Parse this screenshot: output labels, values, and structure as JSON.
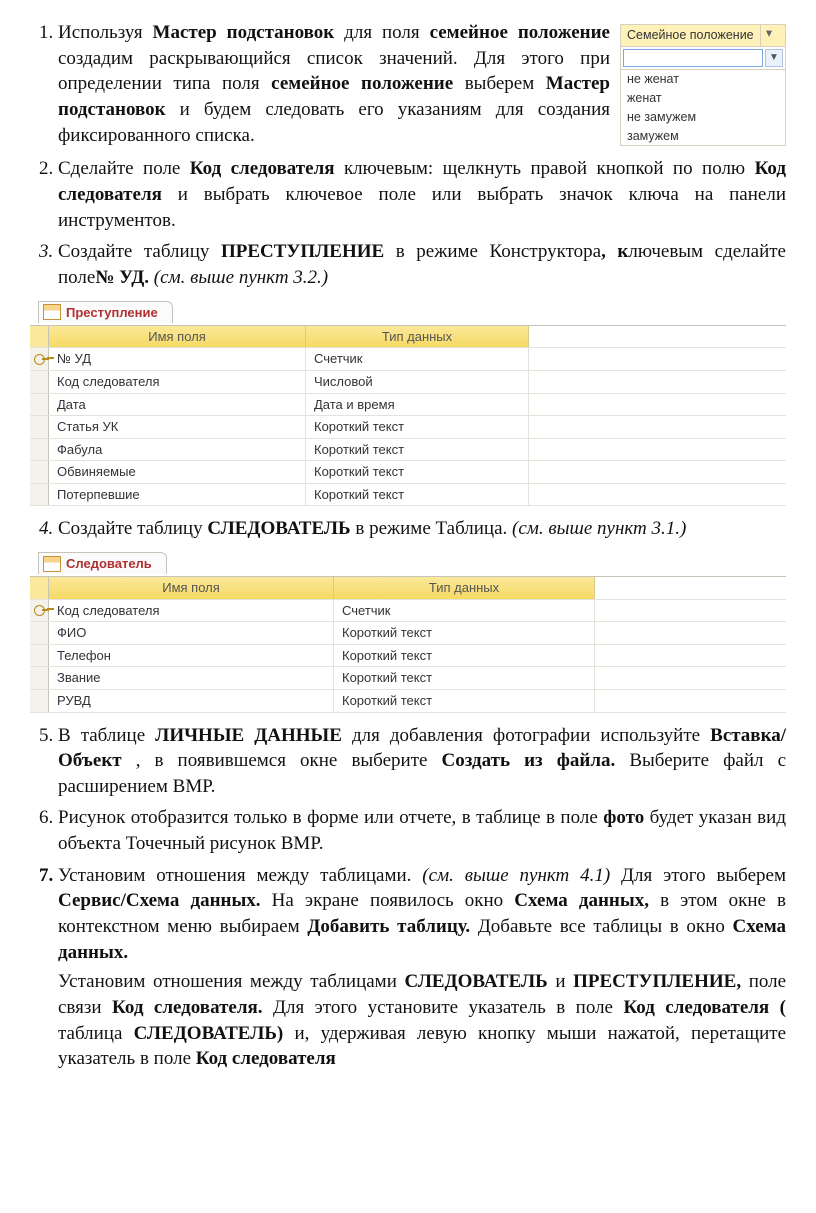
{
  "dropdown": {
    "header": "Семейное положение",
    "arrow": "▾",
    "btn": "▼",
    "options": [
      "не женат",
      "женат",
      "не замужем",
      "замужем"
    ]
  },
  "items": {
    "i1": {
      "t0": "Используя ",
      "b1": "Мастер подстановок",
      "t1": " для поля ",
      "b2": "семейное положение",
      "t2": " создадим раскрывающийся список значений. Для этого при определении типа поля ",
      "b3": "семейное положение",
      "t3": " выберем ",
      "b4": "Мастер подстановок",
      "t4": " и будем следовать его указаниям для создания фиксированного списка."
    },
    "i2": {
      "t0": "Сделайте поле ",
      "b1": "Код следователя",
      "t1": " ключевым: щелкнуть правой кнопкой по полю ",
      "b2": "Код следователя",
      "t2": " и выбрать ключевое поле или выбрать значок ключа на панели инструментов."
    },
    "i3": {
      "t0": "Создайте таблицу ",
      "b1": "ПРЕСТУПЛЕНИЕ",
      "t1": " в режиме Конструктора",
      "b2": ", к",
      "t2": "лючевым сделайте поле",
      "b3": "№ УД.",
      "it": " (см. выше пункт 3.2.)"
    },
    "i4": {
      "t0": "Создайте таблицу ",
      "b1": "СЛЕДОВАТЕЛЬ",
      "t1": " в режиме Таблица. ",
      "it": "(см. выше пункт 3.1.)"
    },
    "i5": {
      "t0": "В таблице ",
      "b1": "ЛИЧНЫЕ ДАННЫЕ",
      "t1": " для добавления фотографии используйте ",
      "b2": "Вставка/Объект",
      "t2": ", в появившемся окне выберите ",
      "b3": "Создать из файла.",
      "t3": " Выберите файл с расширением BMP."
    },
    "i6": {
      "t0": "Рисунок отобразится только в форме или отчете, в таблице в поле ",
      "b1": "фото",
      "t1": " будет указан вид объекта Точечный рисунок BMP."
    },
    "i7": {
      "t0": "Установим отношения между таблицами. ",
      "it": "(см. выше пункт 4.1)",
      "t1": " Для этого выберем ",
      "b1": "Сервис/Схема данных.",
      "t2": " На экране появилось окно ",
      "b2": "Схема данных,",
      "t3": " в этом окне в контекстном меню выбираем ",
      "b3": "Добавить таблицу.",
      "t4": " Добавьте все таблицы в окно ",
      "b4": "Схема данных."
    },
    "p2": {
      "t0": "Установим отношения между таблицами ",
      "b1": "СЛЕДОВАТЕЛЬ",
      "t1": " и ",
      "b2": "ПРЕСТУПЛЕНИЕ,",
      "t2": " поле связи ",
      "b3": "Код следователя.",
      "t3": " Для этого установите указатель в поле ",
      "b4": "Код следователя (",
      "t4": "таблица ",
      "b5": "СЛЕДОВАТЕЛЬ)",
      "t5": " и, удерживая левую кнопку мыши нажатой, перетащите указатель в поле ",
      "b6": "Код следователя"
    }
  },
  "table1": {
    "name": "Преступление",
    "h1": "Имя поля",
    "h2": "Тип данных",
    "rows": [
      {
        "f": "№ УД",
        "t": "Счетчик",
        "key": true
      },
      {
        "f": "Код следователя",
        "t": "Числовой"
      },
      {
        "f": "Дата",
        "t": "Дата и время"
      },
      {
        "f": "Статья УК",
        "t": "Короткий текст"
      },
      {
        "f": "Фабула",
        "t": "Короткий текст"
      },
      {
        "f": "Обвиняемые",
        "t": "Короткий текст"
      },
      {
        "f": "Потерпевшие",
        "t": "Короткий текст"
      }
    ]
  },
  "table2": {
    "name": "Следователь",
    "h1": "Имя поля",
    "h2": "Тип данных",
    "rows": [
      {
        "f": "Код следователя",
        "t": "Счетчик",
        "key": true
      },
      {
        "f": "ФИО",
        "t": "Короткий текст"
      },
      {
        "f": "Телефон",
        "t": "Короткий текст"
      },
      {
        "f": "Звание",
        "t": "Короткий текст"
      },
      {
        "f": "РУВД",
        "t": "Короткий текст"
      }
    ]
  }
}
